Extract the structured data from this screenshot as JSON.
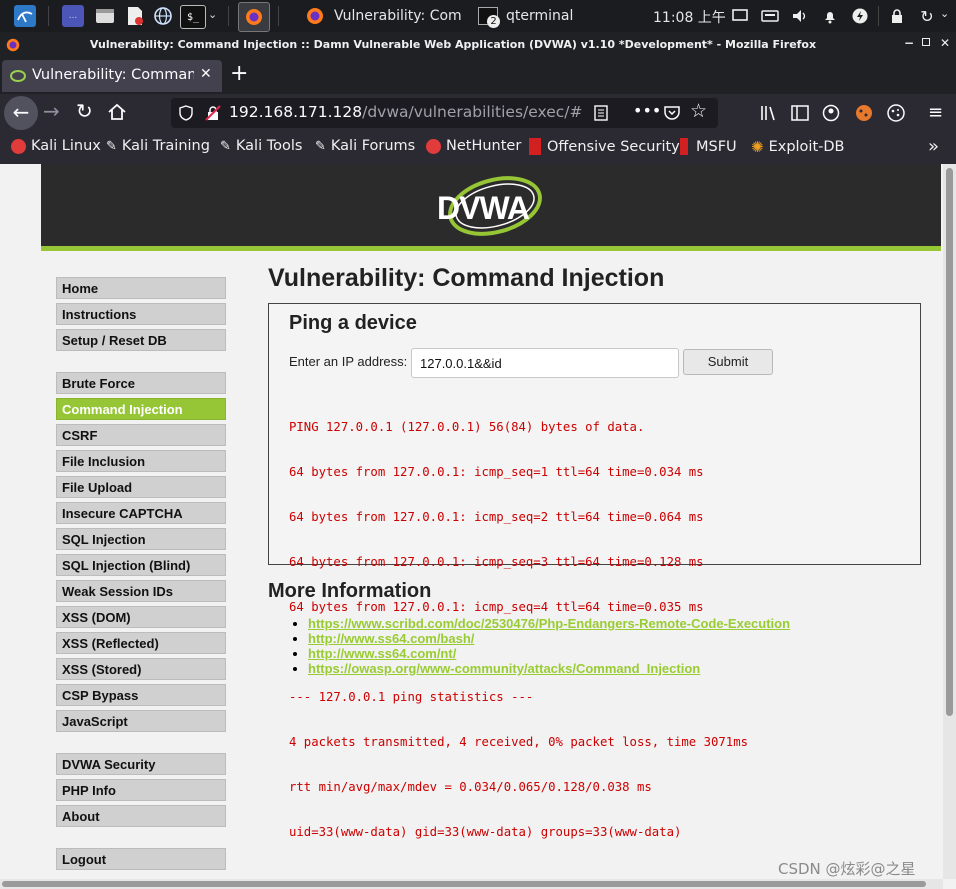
{
  "taskbar": {
    "tasks": [
      {
        "label": "Vulnerability: Com"
      },
      {
        "label": "qterminal",
        "badge": "2"
      }
    ],
    "clock": "11:08 上午"
  },
  "window": {
    "title": "Vulnerability: Command Injection :: Damn Vulnerable Web Application (DVWA) v1.10 *Development* - Mozilla Firefox"
  },
  "tab": {
    "label": "Vulnerability: Command I",
    "new_tab": "+"
  },
  "urlbar": {
    "host": "192.168.171.128",
    "path": "/dvwa/vulnerabilities/exec/#"
  },
  "bookmarks": [
    {
      "label": "Kali Linux"
    },
    {
      "label": "Kali Training"
    },
    {
      "label": "Kali Tools"
    },
    {
      "label": "Kali Forums"
    },
    {
      "label": "NetHunter"
    },
    {
      "label": "Offensive Security"
    },
    {
      "label": "MSFU"
    },
    {
      "label": "Exploit-DB"
    }
  ],
  "logo": "DVWA",
  "menu": {
    "group1": [
      "Home",
      "Instructions",
      "Setup / Reset DB"
    ],
    "group2": [
      "Brute Force",
      "Command Injection",
      "CSRF",
      "File Inclusion",
      "File Upload",
      "Insecure CAPTCHA",
      "SQL Injection",
      "SQL Injection (Blind)",
      "Weak Session IDs",
      "XSS (DOM)",
      "XSS (Reflected)",
      "XSS (Stored)",
      "CSP Bypass",
      "JavaScript"
    ],
    "group3": [
      "DVWA Security",
      "PHP Info",
      "About"
    ],
    "group4": [
      "Logout"
    ],
    "active": "Command Injection"
  },
  "main": {
    "title": "Vulnerability: Command Injection",
    "box_title": "Ping a device",
    "ip_label": "Enter an IP address:",
    "ip_value": "127.0.0.1&&id",
    "submit": "Submit",
    "output": [
      "PING 127.0.0.1 (127.0.0.1) 56(84) bytes of data.",
      "64 bytes from 127.0.0.1: icmp_seq=1 ttl=64 time=0.034 ms",
      "64 bytes from 127.0.0.1: icmp_seq=2 ttl=64 time=0.064 ms",
      "64 bytes from 127.0.0.1: icmp_seq=3 ttl=64 time=0.128 ms",
      "64 bytes from 127.0.0.1: icmp_seq=4 ttl=64 time=0.035 ms",
      "",
      "--- 127.0.0.1 ping statistics ---",
      "4 packets transmitted, 4 received, 0% packet loss, time 3071ms",
      "rtt min/avg/max/mdev = 0.034/0.065/0.128/0.038 ms",
      "uid=33(www-data) gid=33(www-data) groups=33(www-data)"
    ],
    "more_title": "More Information",
    "links": [
      "https://www.scribd.com/doc/2530476/Php-Endangers-Remote-Code-Execution",
      "http://www.ss64.com/bash/",
      "http://www.ss64.com/nt/",
      "https://owasp.org/www-community/attacks/Command_Injection"
    ]
  },
  "watermark": "CSDN @炫彩@之星",
  "colors": {
    "accent_green": "#96c636",
    "output_red": "#cc0000",
    "link_green": "#99cc33",
    "header_dark": "#2b2b2b"
  }
}
